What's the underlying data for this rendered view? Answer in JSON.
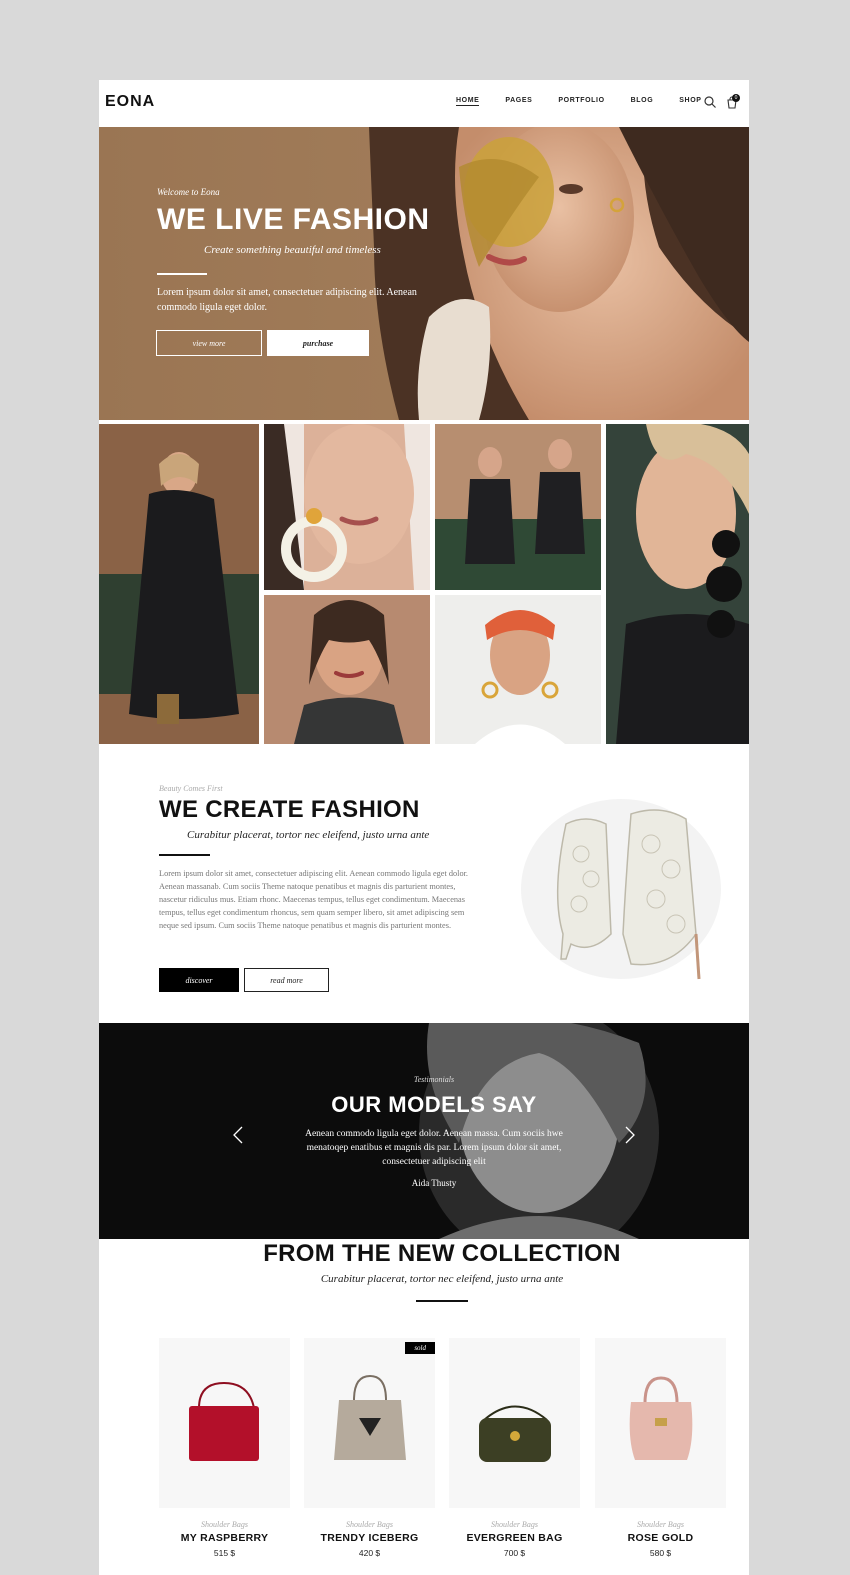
{
  "brand": {
    "logo": "EONA"
  },
  "nav": {
    "items": [
      {
        "label": "HOME",
        "active": true
      },
      {
        "label": "PAGES"
      },
      {
        "label": "PORTFOLIO"
      },
      {
        "label": "BLOG"
      },
      {
        "label": "SHOP"
      }
    ],
    "cart_count": "0"
  },
  "hero": {
    "welcome": "Welcome to Eona",
    "title": "WE LIVE FASHION",
    "subtitle": "Create something beautiful and timeless",
    "text": "Lorem ipsum dolor sit amet, consectetuer adipiscing elit. Aenean commodo ligula eget dolor.",
    "btn_primary": "view more",
    "btn_secondary": "purchase"
  },
  "fashion": {
    "eyebrow": "Beauty Comes First",
    "title": "WE CREATE FASHION",
    "subtitle": "Curabitur placerat, tortor nec eleifend, justo urna ante",
    "text": "Lorem ipsum dolor sit amet, consectetuer adipiscing elit. Aenean commodo ligula eget dolor. Aenean massanab. Cum sociis Theme natoque penatibus et magnis dis parturient montes, nascetur ridiculus mus. Etiam rhonc. Maecenas tempus, tellus eget condimentum. Maecenas tempus, tellus eget condimentum rhoncus, sem quam semper libero, sit amet adipiscing sem neque sed ipsum. Cum sociis Theme natoque penatibus et magnis dis parturient montes.",
    "btn_discover": "discover",
    "btn_read": "read more"
  },
  "testimonials": {
    "eyebrow": "Testimonials",
    "title": "OUR MODELS SAY",
    "quote": "Aenean commodo ligula eget dolor. Aenean massa. Cum sociis hwe menatoqep enatibus et magnis dis par. Lorem ipsum dolor sit amet, consectetuer adipiscing elit",
    "author": "Aida Thusty"
  },
  "collection": {
    "title": "FROM THE NEW COLLECTION",
    "subtitle": "Curabitur placerat, tortor nec eleifend, justo urna ante",
    "products": [
      {
        "category": "Shoulder Bags",
        "name": "MY RASPBERRY",
        "price": "515 $",
        "color": "#b3102a"
      },
      {
        "category": "Shoulder Bags",
        "name": "TRENDY ICEBERG",
        "price": "420 $",
        "color": "#b5aa9c",
        "badge": "sold"
      },
      {
        "category": "Shoulder Bags",
        "name": "EVERGREEN BAG",
        "price": "700 $",
        "color": "#3c3f24"
      },
      {
        "category": "Shoulder Bags",
        "name": "ROSE GOLD",
        "price": "580 $",
        "color": "#e5b8ad"
      }
    ]
  }
}
